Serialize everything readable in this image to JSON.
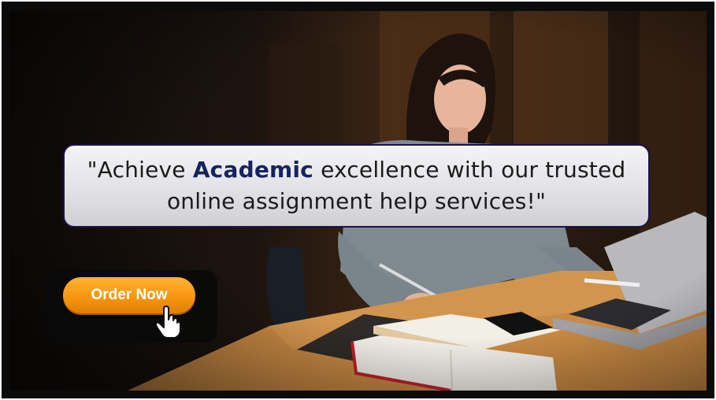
{
  "banner": {
    "quote_before": "\"Achieve ",
    "quote_highlight": "Academic",
    "quote_after": " excellence with our trusted online assignment help services!\""
  },
  "cta": {
    "label": "Order Now",
    "icon": "hand-pointer-icon"
  },
  "colors": {
    "button": "#f6930e",
    "highlight_text": "#16235e",
    "quote_border": "#1a1147"
  }
}
